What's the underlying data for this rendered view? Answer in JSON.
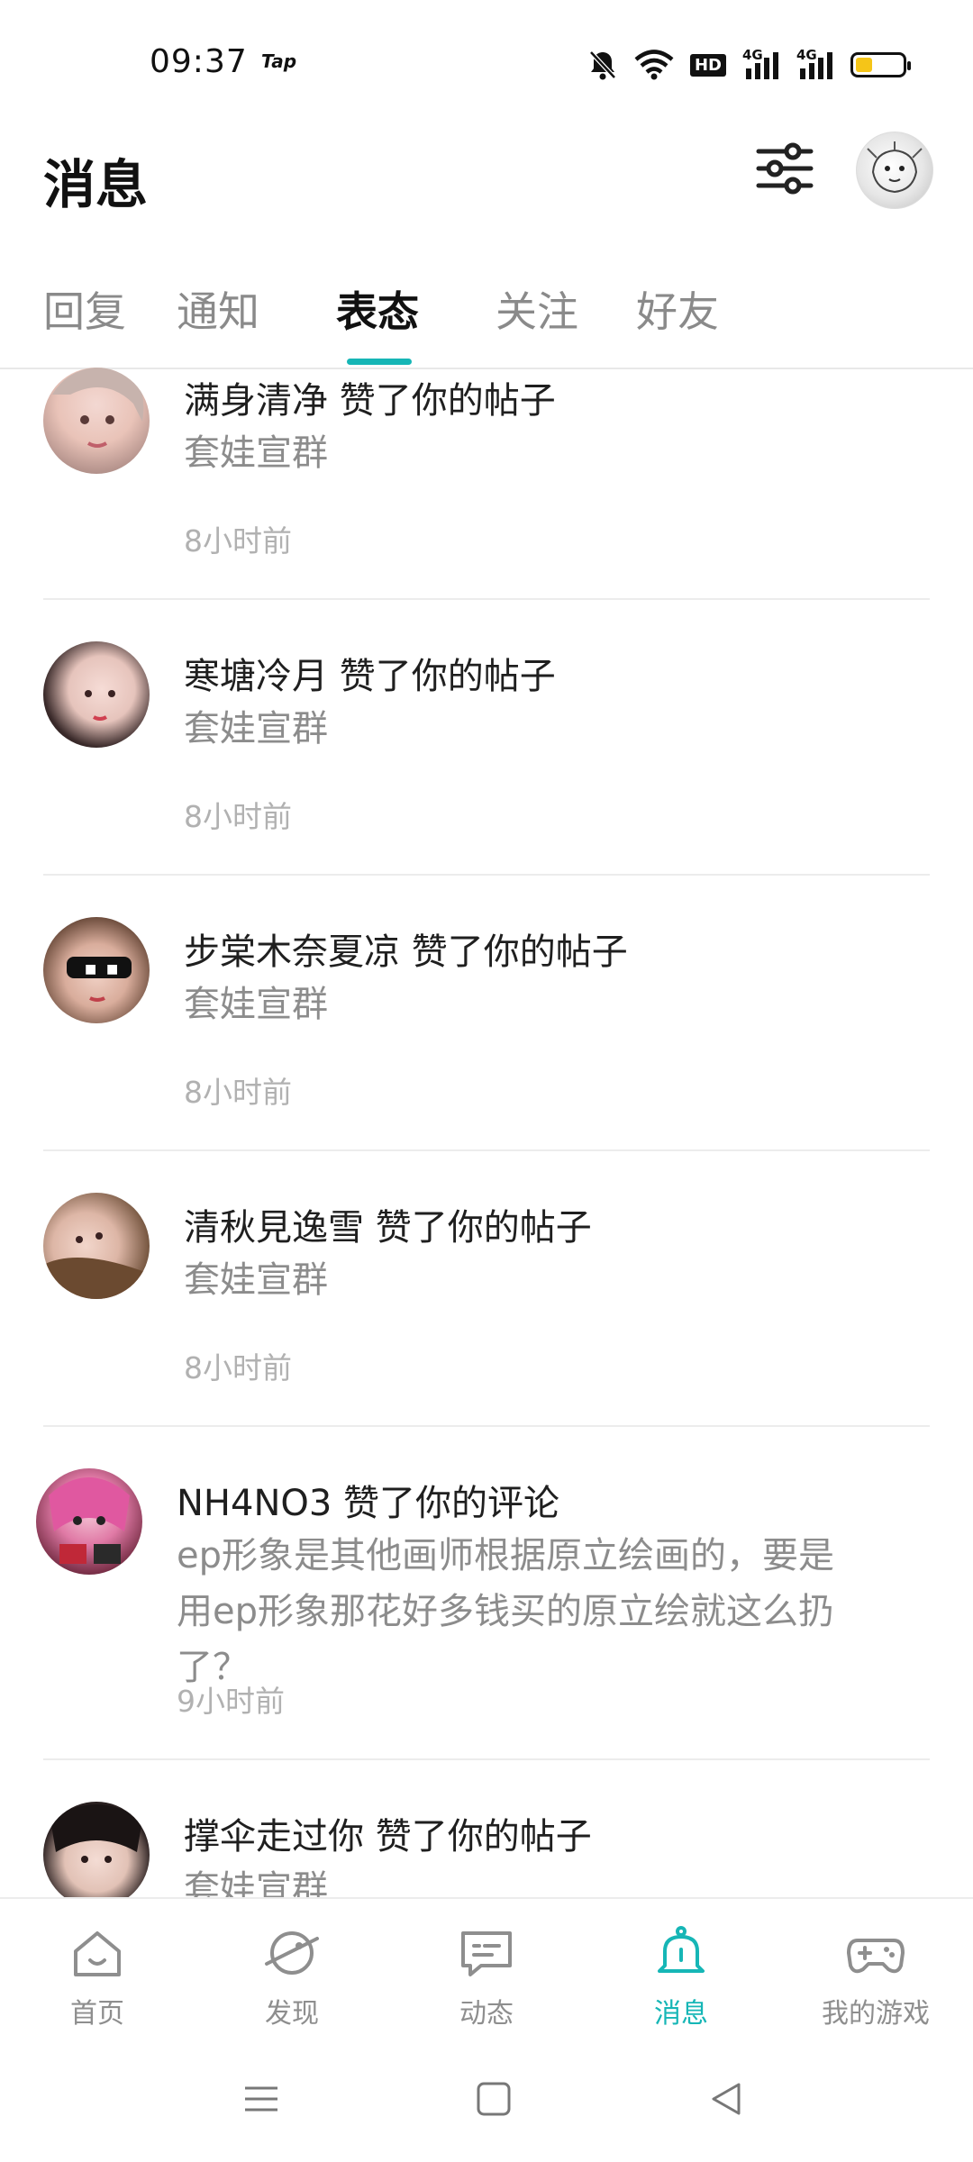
{
  "status_bar": {
    "time": "09:37",
    "app_badge": "Tap",
    "hd_label": "HD",
    "net1": "4G",
    "net2": "4G",
    "battery_level": 0.35,
    "battery_color": "#f5c518"
  },
  "header": {
    "title": "消息"
  },
  "tabs": [
    {
      "label": "回复"
    },
    {
      "label": "通知"
    },
    {
      "label": "表态"
    },
    {
      "label": "关注"
    },
    {
      "label": "好友"
    }
  ],
  "active_tab": "表态",
  "accent_color": "#16b6b6",
  "items": [
    {
      "title": "满身清净 赞了你的帖子",
      "excerpt": "套娃宣群",
      "time": "8小时前"
    },
    {
      "title": "寒塘冷月 赞了你的帖子",
      "excerpt": "套娃宣群",
      "time": "8小时前"
    },
    {
      "title": "步棠木奈夏凉 赞了你的帖子",
      "excerpt": "套娃宣群",
      "time": "8小时前"
    },
    {
      "title": "清秋見逸雪 赞了你的帖子",
      "excerpt": "套娃宣群",
      "time": "8小时前"
    },
    {
      "title": "NH4NO3 赞了你的评论",
      "excerpt": "ep形象是其他画师根据原立绘画的，要是用ep形象那花好多钱买的原立绘就这么扔了？",
      "time": "9小时前"
    },
    {
      "title": "撑伞走过你 赞了你的帖子",
      "excerpt": "套娃宣群",
      "time": ""
    }
  ],
  "bottom_nav": [
    {
      "label": "首页",
      "icon": "home-icon"
    },
    {
      "label": "发现",
      "icon": "discover-icon"
    },
    {
      "label": "动态",
      "icon": "feed-icon"
    },
    {
      "label": "消息",
      "icon": "bell-icon"
    },
    {
      "label": "我的游戏",
      "icon": "gamepad-icon"
    }
  ],
  "active_nav": "消息"
}
